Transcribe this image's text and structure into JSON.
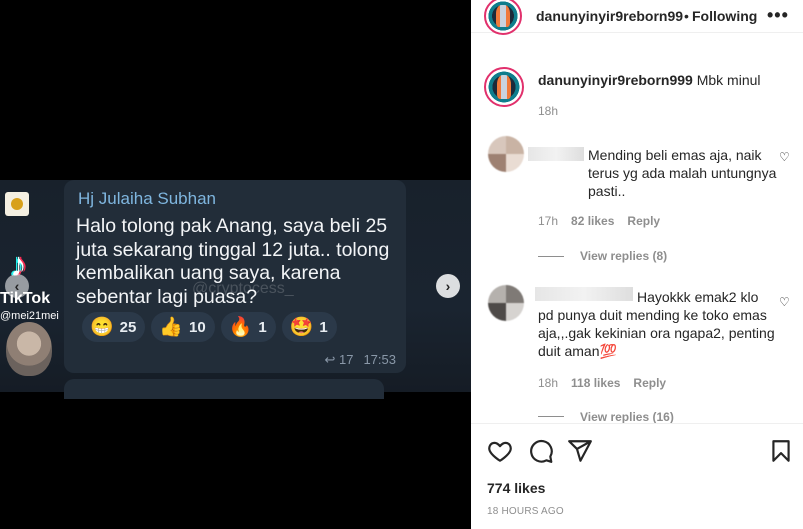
{
  "post": {
    "username": "danunyinyir9reborn99",
    "separator": "•",
    "follow_label": "Following",
    "more_label": "•••",
    "caption_user": "danunyinyir9reborn999",
    "caption_text": "Mbk minul",
    "caption_time": "18h",
    "likes": "774 likes",
    "posted": "18 HOURS AGO"
  },
  "media": {
    "chat": {
      "sender": "Hj Julaiha Subhan",
      "message": "Halo tolong pak Anang, saya beli 25 juta sekarang tinggal 12 juta.. tolong kembalikan uang saya, karena sebentar lagi puasa?",
      "watermark": "@cryptocess_",
      "reactions": [
        {
          "emoji": "😁",
          "count": "25"
        },
        {
          "emoji": "👍",
          "count": "10"
        },
        {
          "emoji": "🔥",
          "count": "1"
        },
        {
          "emoji": "🤩",
          "count": "1"
        }
      ],
      "forward_count": "17",
      "time": "17:53"
    },
    "tiktok": {
      "brand": "TikTok",
      "handle": "@mei21mei"
    }
  },
  "comments": [
    {
      "text": "Mending beli emas aja, naik terus yg ada malah untungnya pasti..",
      "time": "17h",
      "likes": "82 likes",
      "reply_label": "Reply",
      "view_replies": "View replies (8)"
    },
    {
      "text_first": "Hayokkk emak2 klo",
      "text_rest": "pd punya duit mending ke toko emas aja,,.gak kekinian ora ngapa2, penting duit aman💯",
      "time": "18h",
      "likes": "118 likes",
      "reply_label": "Reply",
      "view_replies": "View replies (16)"
    }
  ],
  "icons": {
    "like": "heart-icon",
    "comment": "comment-icon",
    "share": "paper-plane-icon",
    "save": "bookmark-icon",
    "prev": "chevron-left-icon",
    "next": "chevron-right-icon"
  },
  "colors": {
    "story_ring": "#e1306c",
    "chat_bubble": "#222d39",
    "sender_name": "#7fb6df",
    "muted_text": "#8e8e8e"
  }
}
